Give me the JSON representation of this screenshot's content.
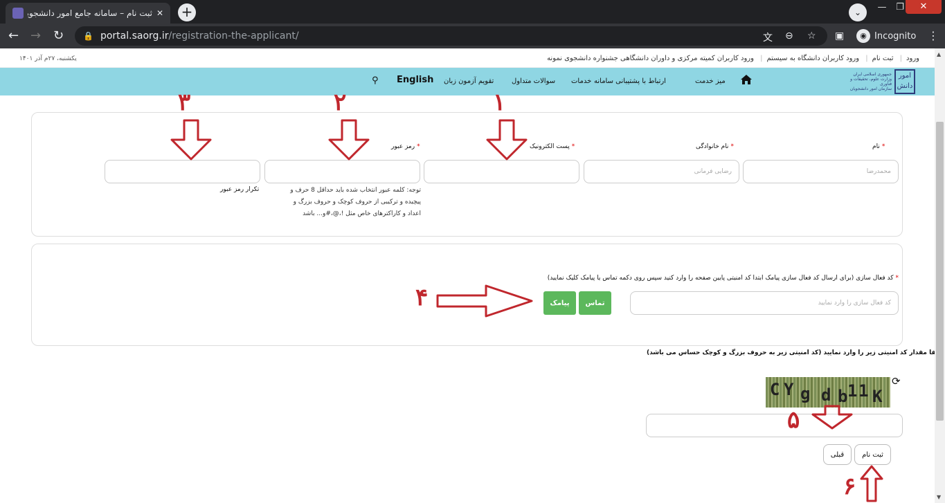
{
  "browser": {
    "tab_title": "ثبت نام – سامانه جامع امور دانشجویان (سج",
    "url_host": "portal.saorg.ir",
    "url_path": "/registration-the-applicant/",
    "incognito_label": "Incognito"
  },
  "topstrip": {
    "links": [
      "ورود",
      "ثبت نام",
      "ورود کاربران دانشگاه به سیستم",
      "ورود کاربران کمیته مرکزی و داوران دانشگاهی جشنواره دانشجوی نمونه"
    ],
    "date": "یکشنبه، ۲۷م آذر ۱۴۰۱"
  },
  "logo": {
    "text": "جمهوری اسلامی ایران\nوزارت علوم، تحقیقات و فناوری\nسازمان امور دانشجویان"
  },
  "nav": {
    "items": [
      "میز خدمت",
      "ارتباط با پشتیبانی سامانه",
      "خدمات",
      "سوالات متداول",
      "تقویم آزمون زبان"
    ],
    "english": "English"
  },
  "form": {
    "first_name_label": "نام",
    "first_name_placeholder": "محمدرضا",
    "last_name_label": "نام خانوادگی",
    "last_name_placeholder": "رضایی فرمانی",
    "email_label": "پست الکترونیک",
    "password_label": "رمز عبور",
    "password_note": "توجه: کلمه عبور انتخاب شده باید حداقل 8 حرف و پیچیده و ترکیبی از حروف کوچک و حروف بزرگ و اعداد و کاراکترهای خاص مثل !،@،#و... باشد",
    "confirm_label": "تکرار رمز عبور",
    "activation_label": "کد فعال سازی (برای ارسال کد فعال سازی پیامک ابتدا کد امنیتی پایین صفحه را وارد کنید سپس روی دکمه تماس یا پیامک کلیک نمایید)",
    "activation_placeholder": "کد فعال سازی را وارد نمایید",
    "call_button": "تماس",
    "sms_button": "پیامک",
    "captcha_instruction": "لطفا مقدار کد امنیتی زیر را وارد نمایید (کد امنیتی زیر به حروف بزرگ و کوچک حساس می باشد)",
    "captcha_text": [
      "C",
      "Y",
      "g",
      "d",
      "b",
      "1",
      "1",
      "K"
    ],
    "submit_button": "ثبت نام",
    "prev_button": "قبلی"
  },
  "annotations": [
    "۱",
    "۲",
    "۳",
    "۴",
    "۵",
    "۶"
  ],
  "colors": {
    "nav_bg": "#8fd6e3",
    "green_button": "#5cb85c",
    "annotation_red": "#c0272d"
  }
}
